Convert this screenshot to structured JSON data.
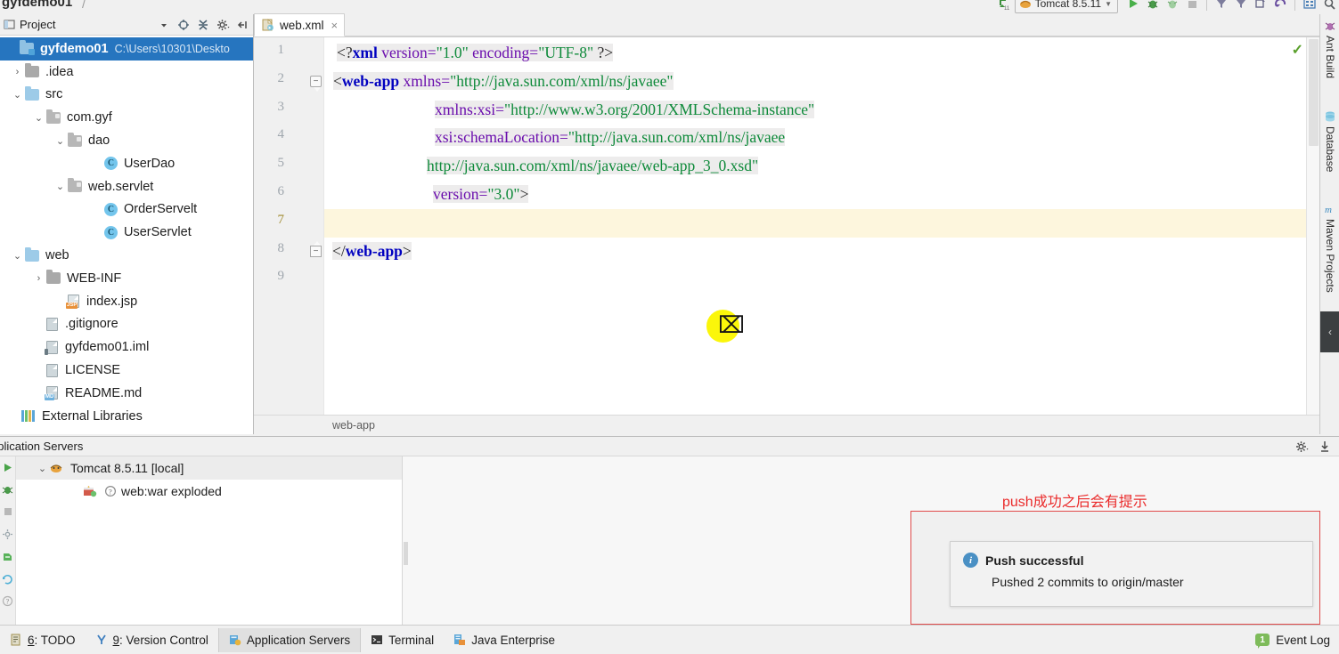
{
  "window": {
    "project_title": "gyfdemo01",
    "run_config": "Tomcat 8.5.11"
  },
  "project_panel": {
    "title": "Project",
    "tools": [
      "collapse-dropdown",
      "locate-icon",
      "collapse-all-icon",
      "settings-icon",
      "hide-icon"
    ],
    "tree": [
      {
        "label": "gyfdemo01",
        "path": "C:\\Users\\10301\\Deskto",
        "icon": "project-folder",
        "arrow": "",
        "indent": 6,
        "selected": true,
        "bold": true
      },
      {
        "label": ".idea",
        "path": "",
        "icon": "folder-grey",
        "arrow": "›",
        "indent": 12,
        "selected": false,
        "bold": false
      },
      {
        "label": "src",
        "path": "",
        "icon": "folder-src",
        "arrow": "⌄",
        "indent": 12,
        "selected": false,
        "bold": false
      },
      {
        "label": "com.gyf",
        "path": "",
        "icon": "folder-package",
        "arrow": "⌄",
        "indent": 36,
        "selected": false,
        "bold": false
      },
      {
        "label": "dao",
        "path": "",
        "icon": "folder-package",
        "arrow": "⌄",
        "indent": 60,
        "selected": false,
        "bold": false
      },
      {
        "label": "UserDao",
        "path": "",
        "icon": "class-icon",
        "arrow": "",
        "indent": 100,
        "selected": false,
        "bold": false
      },
      {
        "label": "web.servlet",
        "path": "",
        "icon": "folder-package",
        "arrow": "⌄",
        "indent": 60,
        "selected": false,
        "bold": false
      },
      {
        "label": "OrderServelt",
        "path": "",
        "icon": "class-icon",
        "arrow": "",
        "indent": 100,
        "selected": false,
        "bold": false
      },
      {
        "label": "UserServlet",
        "path": "",
        "icon": "class-icon",
        "arrow": "",
        "indent": 100,
        "selected": false,
        "bold": false
      },
      {
        "label": "web",
        "path": "",
        "icon": "folder-blue",
        "arrow": "⌄",
        "indent": 12,
        "selected": false,
        "bold": false
      },
      {
        "label": "WEB-INF",
        "path": "",
        "icon": "folder-grey",
        "arrow": "›",
        "indent": 36,
        "selected": false,
        "bold": false
      },
      {
        "label": "index.jsp",
        "path": "",
        "icon": "jsp-file-icon",
        "arrow": "",
        "indent": 58,
        "selected": false,
        "bold": false
      },
      {
        "label": ".gitignore",
        "path": "",
        "icon": "text-file-icon",
        "arrow": "",
        "indent": 34,
        "selected": false,
        "bold": false
      },
      {
        "label": "gyfdemo01.iml",
        "path": "",
        "icon": "iml-file-icon",
        "arrow": "",
        "indent": 34,
        "selected": false,
        "bold": false
      },
      {
        "label": "LICENSE",
        "path": "",
        "icon": "text-file-icon",
        "arrow": "",
        "indent": 34,
        "selected": false,
        "bold": false
      },
      {
        "label": "README.md",
        "path": "",
        "icon": "md-file-icon",
        "arrow": "",
        "indent": 34,
        "selected": false,
        "bold": false
      },
      {
        "label": "External Libraries",
        "path": "",
        "icon": "library-icon",
        "arrow": "",
        "indent": 8,
        "selected": false,
        "bold": false
      }
    ]
  },
  "editor": {
    "tab_label": "web.xml",
    "tab_close": "×",
    "breadcrumb": "web-app",
    "inspection_status": "✓",
    "line_numbers": [
      "1",
      "2",
      "3",
      "4",
      "5",
      "6",
      "7",
      "8",
      "9"
    ],
    "current_line": 7,
    "lines": [
      {
        "n": 1,
        "indent": 14,
        "segments": [
          {
            "t": "<?",
            "c": "punc"
          },
          {
            "t": "xml",
            "c": "pi"
          },
          {
            "t": " version=",
            "c": "attr"
          },
          {
            "t": "\"1.0\"",
            "c": "val"
          },
          {
            "t": " encoding=",
            "c": "attr"
          },
          {
            "t": "\"UTF-8\"",
            "c": "val"
          },
          {
            "t": " ?>",
            "c": "punc"
          }
        ]
      },
      {
        "n": 2,
        "indent": 10,
        "segments": [
          {
            "t": "<",
            "c": "punc"
          },
          {
            "t": "web-app",
            "c": "tag"
          },
          {
            "t": " xmlns=",
            "c": "attr"
          },
          {
            "t": "\"http://java.sun.com/xml/ns/javaee\"",
            "c": "val"
          }
        ]
      },
      {
        "n": 3,
        "indent": 124,
        "segments": [
          {
            "t": "xmlns:xsi=",
            "c": "attr"
          },
          {
            "t": "\"http://www.w3.org/2001/XMLSchema-instance\"",
            "c": "val"
          }
        ]
      },
      {
        "n": 4,
        "indent": 124,
        "segments": [
          {
            "t": "xsi:schemaLocation=",
            "c": "attr"
          },
          {
            "t": "\"http://java.sun.com/xml/ns/javaee",
            "c": "val"
          }
        ]
      },
      {
        "n": 5,
        "indent": 115,
        "segments": [
          {
            "t": "http://java.sun.com/xml/ns/javaee/web-app_3_0.xsd\"",
            "c": "val"
          }
        ]
      },
      {
        "n": 6,
        "indent": 122,
        "segments": [
          {
            "t": "version=",
            "c": "attr"
          },
          {
            "t": "\"3.0\"",
            "c": "val"
          },
          {
            "t": ">",
            "c": "punc"
          }
        ]
      },
      {
        "n": 7,
        "indent": 0,
        "segments": []
      },
      {
        "n": 8,
        "indent": 9,
        "segments": [
          {
            "t": "</",
            "c": "punc"
          },
          {
            "t": "web-app",
            "c": "tag"
          },
          {
            "t": ">",
            "c": "punc"
          }
        ]
      },
      {
        "n": 9,
        "indent": 0,
        "segments": []
      }
    ]
  },
  "right_rail": [
    {
      "label": "Ant Build",
      "icon": "ant-icon"
    },
    {
      "label": "Database",
      "icon": "database-icon"
    },
    {
      "label": "Maven Projects",
      "icon": "maven-icon"
    }
  ],
  "app_servers": {
    "title": "pplication Servers",
    "tools": [
      "settings-icon",
      "hide-icon"
    ],
    "rail_icons": [
      "run-icon",
      "debug-icon",
      "stop-icon",
      "settings-icon",
      "deploy-icon",
      "refresh-icon",
      "help-icon"
    ],
    "tree": [
      {
        "label": "Tomcat 8.5.11 [local]",
        "icon": "tomcat-icon",
        "arrow": "⌄",
        "indent": 22,
        "selected": true
      },
      {
        "label": "web:war exploded",
        "icon": "artifact-icon",
        "arrow": "",
        "indent": 60,
        "selected": false
      }
    ]
  },
  "notification": {
    "annotation": "push成功之后会有提示",
    "icon": "info-icon",
    "title": "Push successful",
    "subtitle": "Pushed 2 commits to origin/master",
    "annotation_color": "#ea2a2a"
  },
  "status_bar": {
    "tabs": [
      {
        "num": "6",
        "label": ": TODO",
        "icon": "todo-icon",
        "active": false
      },
      {
        "num": "9",
        "label": ": Version Control",
        "icon": "vcs-icon",
        "active": false
      },
      {
        "num": "",
        "label": "Application Servers",
        "icon": "app-servers-icon",
        "active": true
      },
      {
        "num": "",
        "label": "Terminal",
        "icon": "terminal-icon",
        "active": false
      },
      {
        "num": "",
        "label": "Java Enterprise",
        "icon": "java-ee-icon",
        "active": false
      }
    ],
    "event_log_label": "Event Log",
    "event_log_count": "1"
  }
}
